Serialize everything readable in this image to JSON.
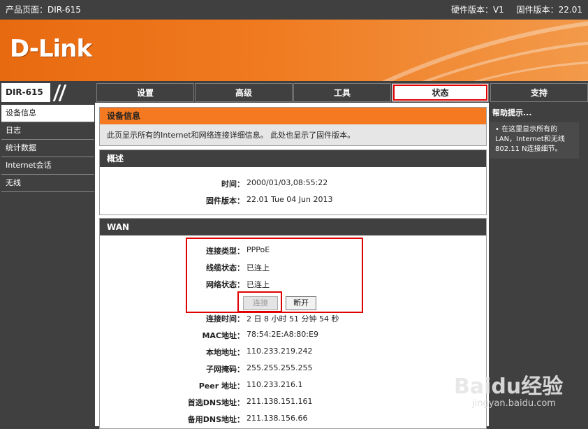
{
  "topbar": {
    "product": "产品页面：DIR-615",
    "hardware": "硬件版本：V1",
    "firmware": "固件版本：22.01"
  },
  "banner": {
    "logo": "D-Link"
  },
  "nav": {
    "model": "DIR-615",
    "tabs": [
      {
        "label": "设置"
      },
      {
        "label": "高级"
      },
      {
        "label": "工具"
      },
      {
        "label": "状态"
      },
      {
        "label": "支持"
      }
    ],
    "active_tab": "状态"
  },
  "sidebar": {
    "items": [
      {
        "label": "设备信息"
      },
      {
        "label": "日志"
      },
      {
        "label": "统计数据"
      },
      {
        "label": "Internet会话"
      },
      {
        "label": "无线"
      }
    ]
  },
  "device_info": {
    "title": "设备信息",
    "description": "此页显示所有的Internet和网络连接详细信息。 此处也显示了固件版本。"
  },
  "overview": {
    "title": "概述",
    "rows": [
      {
        "label": "时间：",
        "value": "2000/01/03,08:55:22"
      },
      {
        "label": "固件版本：",
        "value": "22.01 Tue 04 Jun 2013"
      }
    ]
  },
  "wan": {
    "title": "WAN",
    "rows_top": [
      {
        "label": "连接类型：",
        "value": "PPPoE"
      },
      {
        "label": "线缆状态：",
        "value": "已连上"
      },
      {
        "label": "网络状态：",
        "value": "已连上"
      }
    ],
    "connect_button": "连接",
    "disconnect_button": "断开",
    "rows_bottom": [
      {
        "label": "连接时间：",
        "value": "2 日 8 小时 51 分钟 54 秒"
      },
      {
        "label": "MAC地址：",
        "value": "78:54:2E:A8:80:E9"
      },
      {
        "label": "本地地址：",
        "value": "110.233.219.242"
      },
      {
        "label": "子网掩码：",
        "value": "255.255.255.255"
      },
      {
        "label": "Peer 地址：",
        "value": "110.233.216.1"
      },
      {
        "label": "首选DNS地址：",
        "value": "211.138.151.161"
      },
      {
        "label": "备用DNS地址：",
        "value": "211.138.156.66"
      }
    ]
  },
  "help": {
    "title": "帮助提示...",
    "tip": "在这里显示所有的LAN，Internet和无线802.11 N连接细节。"
  },
  "watermark": {
    "brand": "Baidu经验",
    "url": "jingyan.baidu.com"
  },
  "colors": {
    "accent": "#f47920",
    "dark": "#404040",
    "highlight": "#e00000"
  }
}
